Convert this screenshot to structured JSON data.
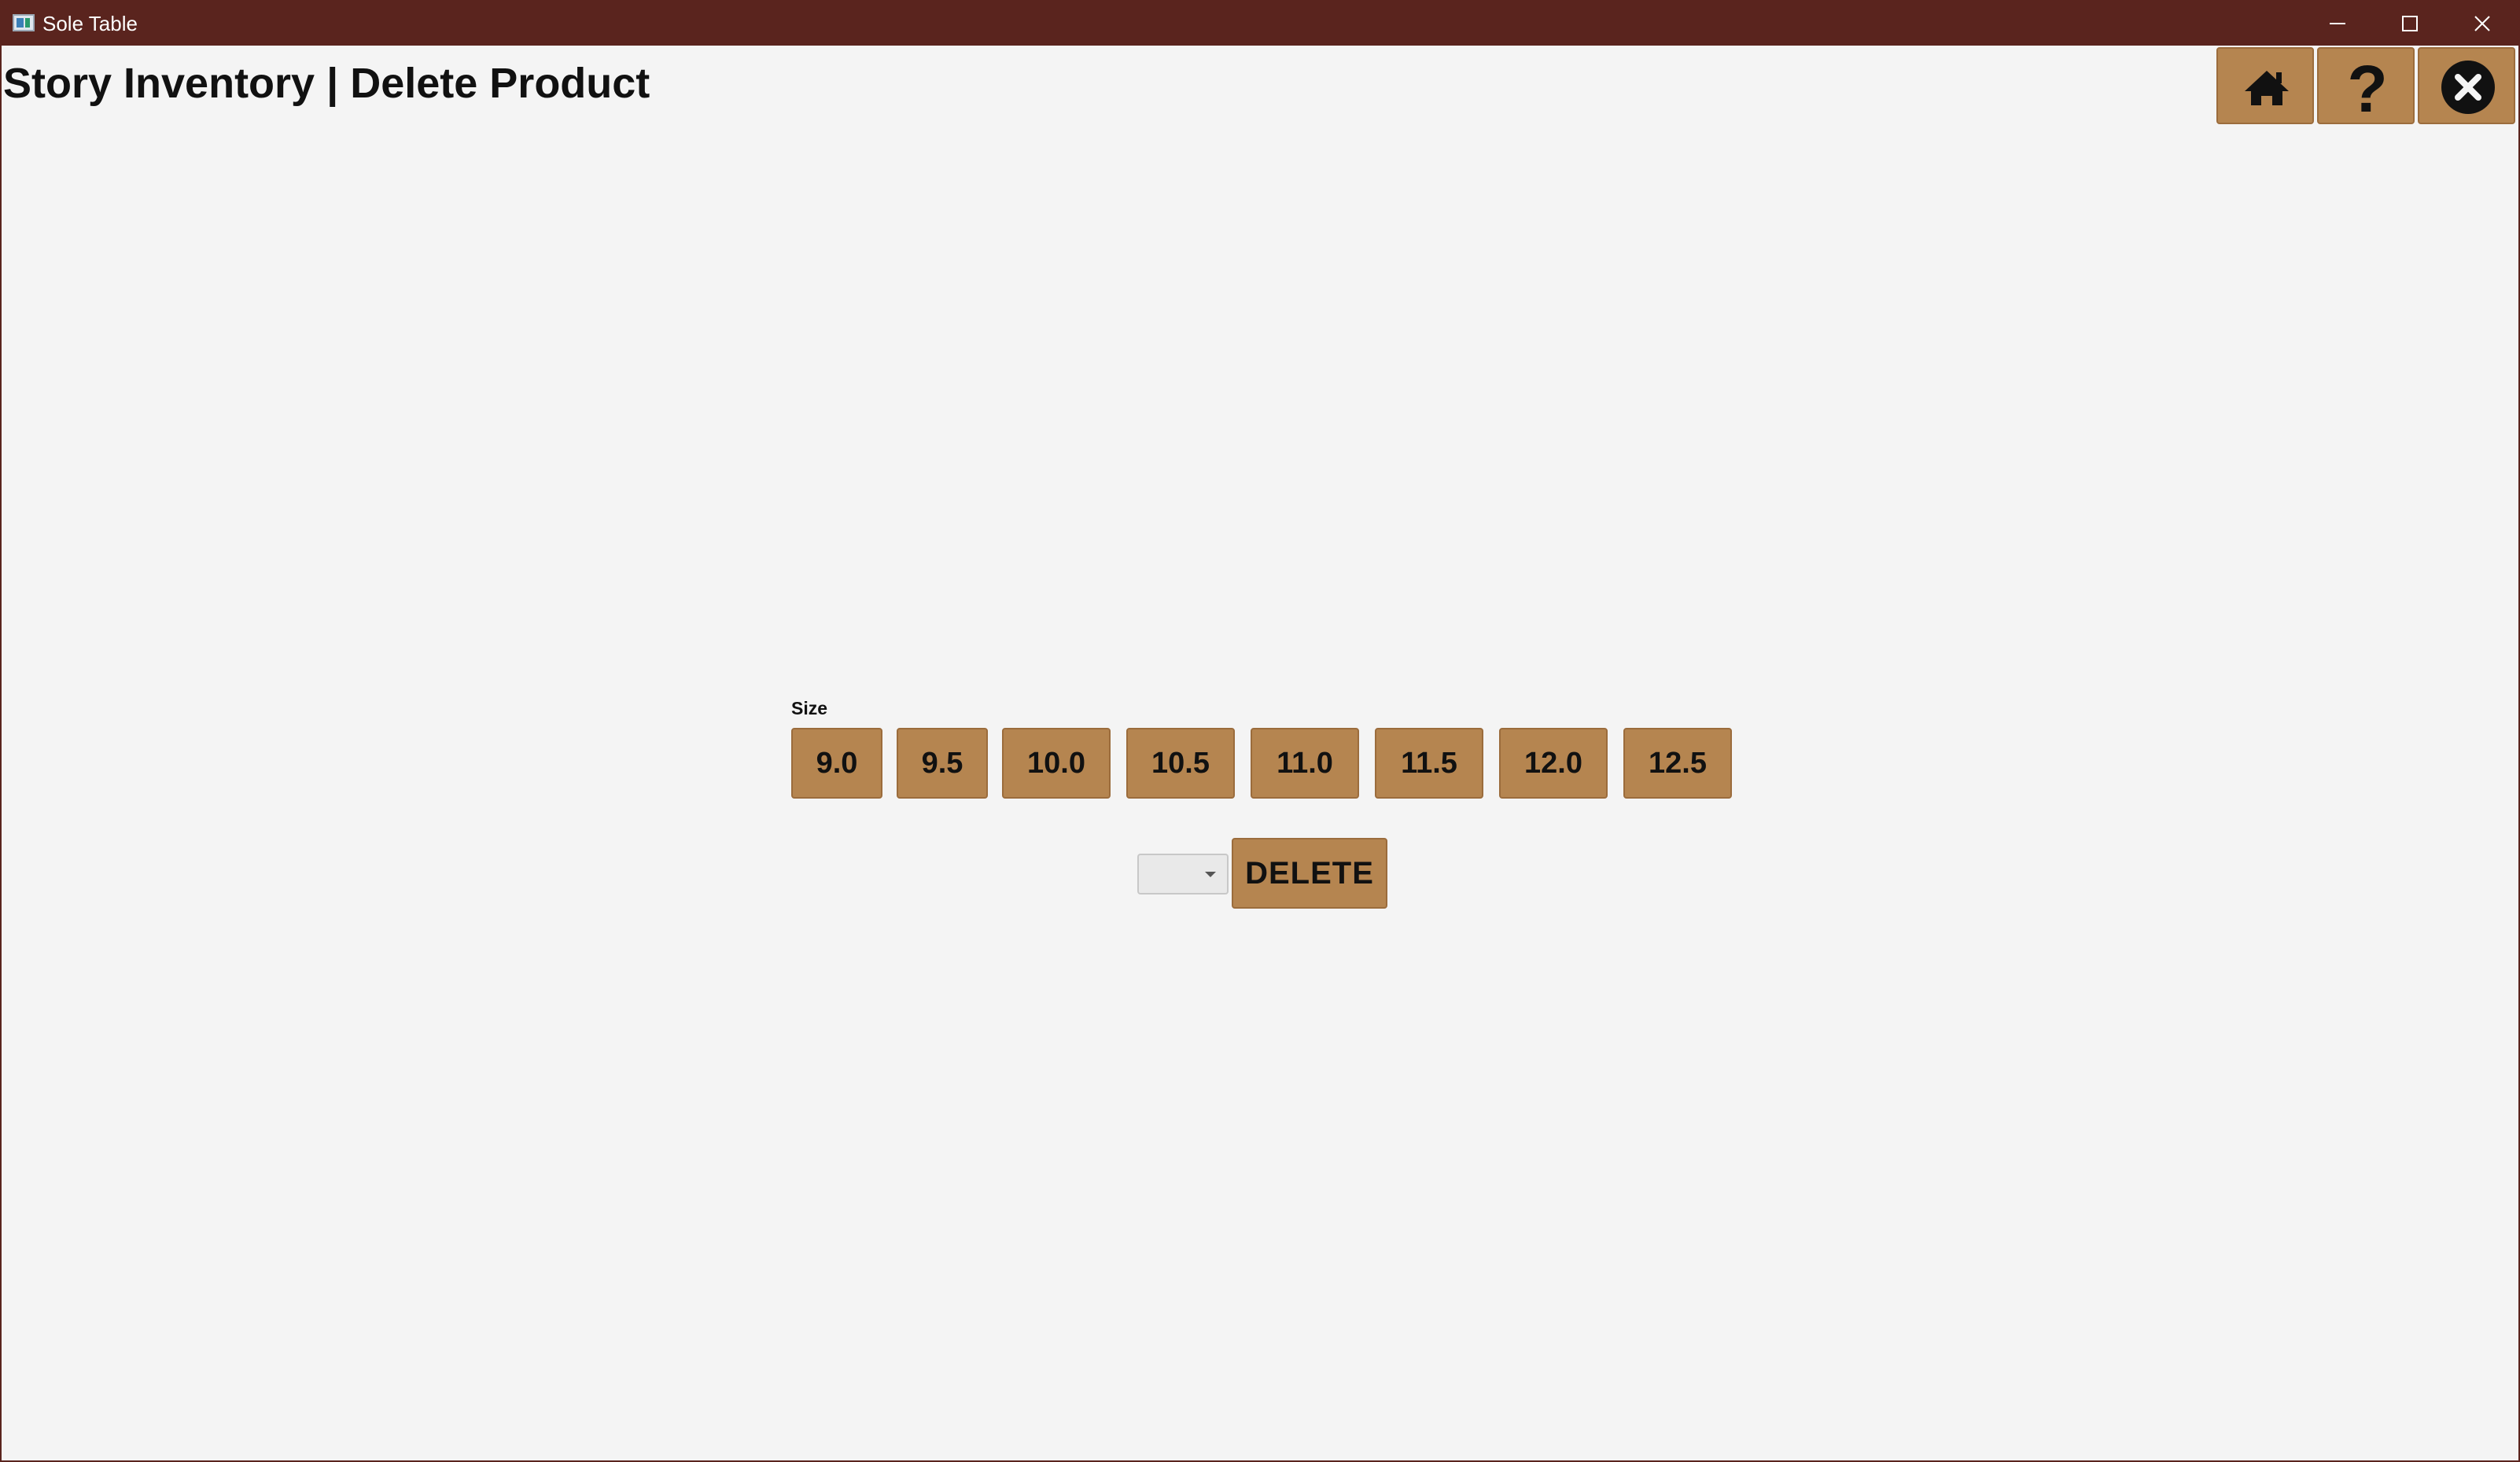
{
  "window": {
    "title": "Sole Table",
    "controls": [
      "minimize-icon",
      "maximize-icon",
      "close-icon"
    ]
  },
  "header": {
    "title": "Story Inventory | Delete Product",
    "toolbar": [
      {
        "name": "home",
        "icon": "home-icon"
      },
      {
        "name": "help",
        "icon": "question-mark-icon"
      },
      {
        "name": "exit",
        "icon": "circle-x-icon"
      }
    ]
  },
  "size_selector": {
    "label": "Size",
    "options": [
      "9.0",
      "9.5",
      "10.0",
      "10.5",
      "11.0",
      "11.5",
      "12.0",
      "12.5"
    ]
  },
  "delete_form": {
    "selected_value": "",
    "delete_label": "DELETE"
  },
  "colors": {
    "titlebar": "#5a241e",
    "button_fill": "#b58550",
    "button_border": "#9b6c3c",
    "background": "#f4f4f4",
    "text": "#111111"
  }
}
